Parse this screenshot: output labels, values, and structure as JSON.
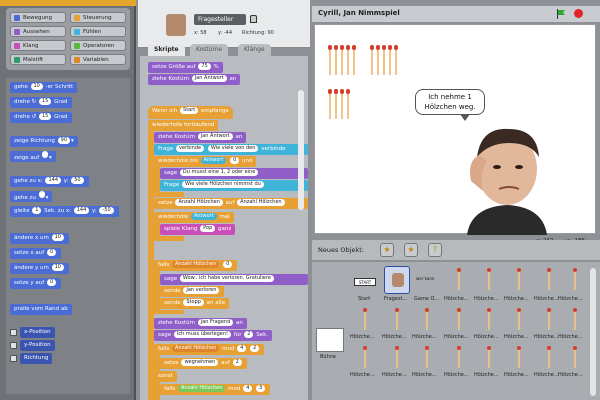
{
  "categories": [
    {
      "label": "Bewegung",
      "color": "#4a6cd4"
    },
    {
      "label": "Steuerung",
      "color": "#e6a033"
    },
    {
      "label": "Aussehen",
      "color": "#8f5ec9"
    },
    {
      "label": "Fühlen",
      "color": "#3fb4d8"
    },
    {
      "label": "Klang",
      "color": "#c94fb8"
    },
    {
      "label": "Operatoren",
      "color": "#59b83a"
    },
    {
      "label": "Malstift",
      "color": "#2e9c6a"
    },
    {
      "label": "Variablen",
      "color": "#e0862a"
    }
  ],
  "palette_blocks": {
    "move": "gehe",
    "move_val": "10",
    "move_suffix": "-er Schritt",
    "turn_r": "drehe",
    "turn_r_val": "15",
    "turn_r_suffix": "Grad",
    "turn_l": "drehe",
    "turn_l_val": "15",
    "turn_l_suffix": "Grad",
    "point_dir": "zeige Richtung",
    "point_dir_val": "90",
    "point_to": "zeige auf",
    "goto": "gehe zu x:",
    "goto_x": "144",
    "goto_y_label": "y:",
    "goto_y": "50",
    "goto2": "gehe zu",
    "glide": "gleite",
    "glide_val": "1",
    "glide_mid": "Sek. zu x:",
    "glide_x": "144",
    "glide_y_label": "y:",
    "glide_y": "-50",
    "change_x": "ändere x um",
    "change_x_val": "10",
    "set_x": "setze x auf",
    "set_x_val": "0",
    "change_y": "ändere y um",
    "change_y_val": "10",
    "set_y": "setze y auf",
    "set_y_val": "0",
    "bounce": "pralle vom Rand ab",
    "xpos": "x-Position",
    "ypos": "y-Position",
    "direction": "Richtung"
  },
  "sprite": {
    "name": "Fragesteller",
    "x_label": "x:",
    "x": "58",
    "y_label": "y:",
    "y": "-44",
    "dir_label": "Richtung:",
    "dir": "90"
  },
  "tabs": [
    "Skripte",
    "Kostüme",
    "Klänge"
  ],
  "scripts": {
    "size": "setze Größe auf",
    "size_val": "75",
    "size_unit": "%",
    "costume": "ziehe Kostüm",
    "costume_val": "Jan Antwort",
    "costume_suffix": "an",
    "when_receive": "Wenn ich",
    "when_receive_val": "Start",
    "when_receive_suffix": "empfange",
    "forever": "wiederhole fortlaufend",
    "costume2": "ziehe Kostüm",
    "costume2_val": "Jan Antwort",
    "costume2_suffix": "an",
    "ask": "Frage",
    "ask_val": "verbinde",
    "ask_text": "Wie viele von den",
    "ask_tail": "verbinde",
    "repeat_until": "wiederhole bis",
    "repeat_until_val": "Antwort",
    "repeat_until_op": "0",
    "repeat_until_and": "und",
    "say1": "sage",
    "say1_val": "Du musst eine 1, 2 oder eine",
    "ask2": "Frage",
    "ask2_val": "Wie viele Hölzchen nimmst du",
    "set_var": "setze",
    "set_var_val": "Anzahl Hölzchen",
    "set_var_mid": "auf",
    "set_var_tail": "Anzahl Hölzchen",
    "repeat_n": "wiederhole",
    "repeat_n_val": "Antwort",
    "repeat_n_suffix": "mal",
    "sound": "spiele Klang",
    "sound_val": "Pop",
    "sound_suffix": "ganz",
    "if1": "falls",
    "if1_val": "Anzahl Hölzchen",
    "if1_op": "0",
    "say2": "sage",
    "say2_val": "Wow.. ich habe verloren. Gratuliere",
    "broadcast": "sende",
    "broadcast_val": "Jan verloren",
    "stop": "sende",
    "stop_val": "Stopp",
    "stop_suffix": "an alle",
    "costume3": "ziehe Kostüm",
    "costume3_val": "Jan Fragend",
    "costume3_suffix": "an",
    "say3": "sage",
    "say3_val": "Ich muss überlegen!",
    "say3_mid": "für",
    "say3_num": "2",
    "say3_unit": "Sek.",
    "if2": "falls",
    "if2_val": "Anzahl Hölzchen",
    "if2_mod": "mod",
    "if2_num": "4",
    "if2_op": "2",
    "set2": "setze",
    "set2_val": "wegnehmen",
    "set2_mid": "auf",
    "set2_num": "2",
    "else": "sonst",
    "if3": "falls",
    "if3_val": "Anzahl Hölzchen",
    "if3_mod": "mod",
    "if3_num": "4",
    "if3_op": "3"
  },
  "stage": {
    "title": "Cyrill, Jan Nimmspiel",
    "bubble": "Ich nehme 1 Hölzchen weg.",
    "coord_x_label": "x:",
    "coord_x": "242",
    "coord_y_label": "y:",
    "coord_y": "-186"
  },
  "new_object_label": "Neues Objekt:",
  "sprite_list": {
    "stage_label": "Bühne",
    "items": [
      "Start",
      "Fragest...",
      "Game O...",
      "Hölzche...",
      "Hölzche...",
      "Hölzche...",
      "Hölzche...",
      "Hölzche...",
      "Hölzche...",
      "Hölzche...",
      "Hölzche...",
      "Hölzche...",
      "Hölzche...",
      "Hölzche...",
      "Hölzche...",
      "Hölzche...",
      "Hölzche...",
      "Hölzche...",
      "Hölzche...",
      "Hölzche...",
      "Hölzche...",
      "Hölzche...",
      "Hölzche...",
      "Hölzche..."
    ],
    "start_badge": "START",
    "tiny_label": "wer kann"
  }
}
